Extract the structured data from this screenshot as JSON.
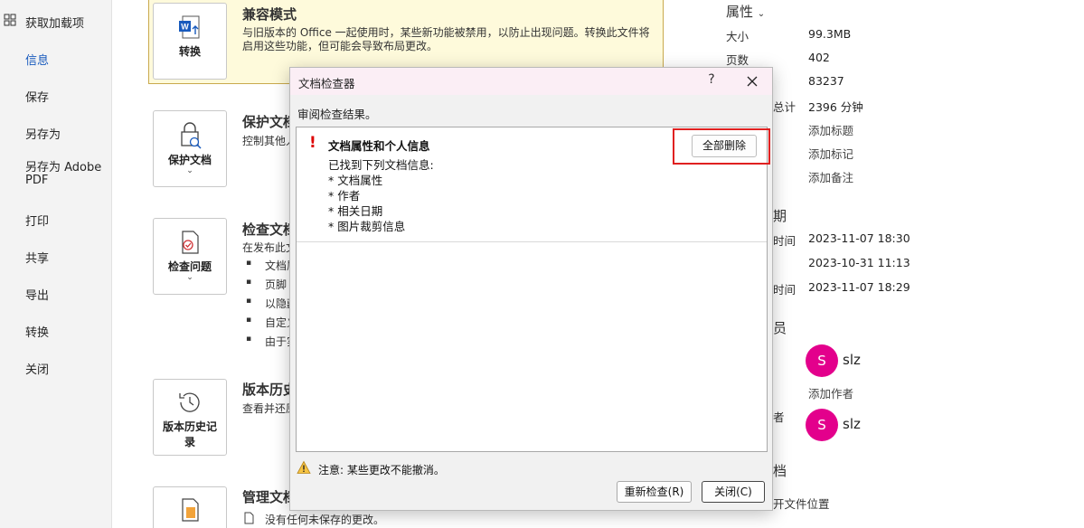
{
  "nav": {
    "items": [
      {
        "label": "获取加载项"
      },
      {
        "label": "信息"
      },
      {
        "label": "保存"
      },
      {
        "label": "另存为"
      },
      {
        "label": "另存为 Adobe PDF"
      },
      {
        "label": "打印"
      },
      {
        "label": "共享"
      },
      {
        "label": "导出"
      },
      {
        "label": "转换"
      },
      {
        "label": "关闭"
      }
    ],
    "active": "信息"
  },
  "main": {
    "compat": {
      "button": "转换",
      "title": "兼容模式",
      "desc1": "与旧版本的 Office 一起使用时，某些新功能被禁用，以防止出现问题。转换此文件将",
      "desc2": "启用这些功能，但可能会导致布局更改。"
    },
    "protect": {
      "button": "保护文档",
      "title": "保护文档",
      "desc": "控制其他人"
    },
    "inspect": {
      "button": "检查问题",
      "title": "检查文档",
      "desc": "在发布此文",
      "bullets": [
        "文档属",
        "页脚",
        "以隐藏",
        "自定义",
        "由于实"
      ]
    },
    "version": {
      "button_line1": "版本历史记",
      "button_line2": "录",
      "title": "版本历史",
      "desc": "查看并还原"
    },
    "manage": {
      "title": "管理文档",
      "desc": "没有任何未保存的更改。"
    }
  },
  "props": {
    "header": "属性",
    "rows": [
      {
        "label": "大小",
        "value": "99.3MB"
      },
      {
        "label": "页数",
        "value": "402"
      },
      {
        "label": "",
        "value": "83237"
      },
      {
        "label": "总计",
        "value": "2396 分钟"
      },
      {
        "label": "",
        "value": "添加标题"
      },
      {
        "label": "",
        "value": "添加标记"
      },
      {
        "label": "",
        "value": "添加备注"
      }
    ],
    "dates_header": "期",
    "dates": [
      {
        "label": "时间",
        "value": "2023-11-07 18:30"
      },
      {
        "label": "",
        "value": "2023-10-31 11:13"
      },
      {
        "label": "时间",
        "value": "2023-11-07 18:29"
      }
    ],
    "people_header": "员",
    "author": {
      "initial": "S",
      "name": "slz"
    },
    "add_author": "添加作者",
    "last_modified_label": "者",
    "last_modified": {
      "initial": "S",
      "name": "slz"
    },
    "docs_header": "档",
    "open_location": "开文件位置",
    "accent_avatar": "#e3008c"
  },
  "dialog": {
    "title": "文档检查器",
    "help": "?",
    "subtitle": "审阅检查结果。",
    "result": {
      "title": "文档属性和个人信息",
      "line0": "已找到下列文档信息:",
      "items": [
        "* 文档属性",
        "* 作者",
        "* 相关日期",
        "* 图片裁剪信息"
      ]
    },
    "remove_all": "全部删除",
    "warning": "注意: 某些更改不能撤消。",
    "reinspect": "重新检查(R)",
    "close": "关闭(C)"
  }
}
